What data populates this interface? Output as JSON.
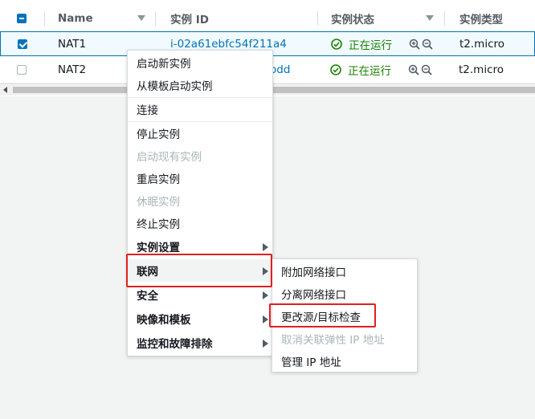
{
  "table": {
    "header": {
      "name": "Name",
      "instance_id": "实例 ID",
      "instance_state": "实例状态",
      "instance_type": "实例类型"
    },
    "rows": [
      {
        "name": "NAT1",
        "instance_id": "i-02a61ebfc54f211a4",
        "state": "正在运行",
        "type": "t2.micro",
        "selected": true
      },
      {
        "name": "NAT2",
        "instance_id_partial": "odd",
        "state": "正在运行",
        "type": "t2.micro",
        "selected": false
      }
    ]
  },
  "context_menu": {
    "items": [
      {
        "label": "启动新实例",
        "enabled": true
      },
      {
        "label": "从模板启动实例",
        "enabled": true
      },
      {
        "label": "连接",
        "enabled": true
      },
      {
        "label": "停止实例",
        "enabled": true
      },
      {
        "label": "启动现有实例",
        "enabled": false
      },
      {
        "label": "重启实例",
        "enabled": true
      },
      {
        "label": "休眠实例",
        "enabled": false
      },
      {
        "label": "终止实例",
        "enabled": true
      },
      {
        "label": "实例设置",
        "submenu": true
      },
      {
        "label": "联网",
        "submenu": true,
        "highlighted": true
      },
      {
        "label": "安全",
        "submenu": true
      },
      {
        "label": "映像和模板",
        "submenu": true
      },
      {
        "label": "监控和故障排除",
        "submenu": true
      }
    ]
  },
  "networking_submenu": {
    "items": [
      {
        "label": "附加网络接口",
        "enabled": true
      },
      {
        "label": "分离网络接口",
        "enabled": true
      },
      {
        "label": "更改源/目标检查",
        "enabled": true,
        "highlighted": true
      },
      {
        "label": "取消关联弹性 IP 地址",
        "enabled": false
      },
      {
        "label": "管理 IP 地址",
        "enabled": true
      }
    ]
  },
  "colors": {
    "accent": "#0073bb",
    "running_green": "#1d8102",
    "highlight_red": "#e02020"
  }
}
